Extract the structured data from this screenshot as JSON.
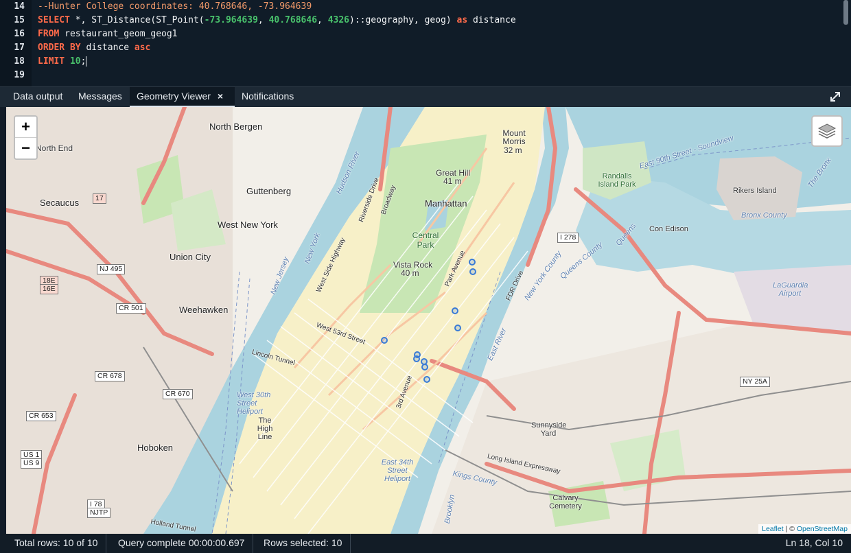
{
  "editor": {
    "lines": [
      {
        "n": "14",
        "parts": [
          {
            "t": "--Hunter College coordinates: 40.768646, -73.964639",
            "c": "comment"
          }
        ]
      },
      {
        "n": "15",
        "parts": [
          {
            "t": "SELECT",
            "c": "kw"
          },
          {
            "t": " *, ST_Distance(ST_Point(",
            "c": "plain"
          },
          {
            "t": "-73.964639",
            "c": "num"
          },
          {
            "t": ", ",
            "c": "plain"
          },
          {
            "t": "40.768646",
            "c": "num"
          },
          {
            "t": ", ",
            "c": "plain"
          },
          {
            "t": "4326",
            "c": "num"
          },
          {
            "t": ")::geography, geog) ",
            "c": "plain"
          },
          {
            "t": "as",
            "c": "kw"
          },
          {
            "t": " distance",
            "c": "plain"
          }
        ]
      },
      {
        "n": "16",
        "parts": [
          {
            "t": "FROM",
            "c": "kw"
          },
          {
            "t": " restaurant_geom_geog1",
            "c": "plain"
          }
        ]
      },
      {
        "n": "17",
        "parts": [
          {
            "t": "ORDER BY",
            "c": "kw"
          },
          {
            "t": " distance ",
            "c": "plain"
          },
          {
            "t": "asc",
            "c": "kw"
          }
        ]
      },
      {
        "n": "18",
        "parts": [
          {
            "t": "LIMIT",
            "c": "kw"
          },
          {
            "t": " ",
            "c": "plain"
          },
          {
            "t": "10",
            "c": "num"
          },
          {
            "t": ";",
            "c": "plain"
          }
        ]
      },
      {
        "n": "19",
        "parts": []
      }
    ]
  },
  "tabs": [
    {
      "label": "Data output",
      "active": false
    },
    {
      "label": "Messages",
      "active": false
    },
    {
      "label": "Geometry Viewer",
      "active": true,
      "close": "×"
    },
    {
      "label": "Notifications",
      "active": false
    }
  ],
  "map": {
    "zoom_in": "+",
    "zoom_out": "−",
    "places": [
      {
        "name": "North Bergen",
        "cls": "big"
      },
      {
        "name": "North End",
        "cls": ""
      },
      {
        "name": "Secaucus",
        "cls": "big"
      },
      {
        "name": "Guttenberg",
        "cls": "big"
      },
      {
        "name": "West New York",
        "cls": "big"
      },
      {
        "name": "Union City",
        "cls": "big"
      },
      {
        "name": "Weehawken",
        "cls": "big"
      },
      {
        "name": "Hoboken",
        "cls": "big"
      },
      {
        "name": "Manhattan",
        "cls": "big"
      },
      {
        "name": "Great Hill",
        "cls": ""
      },
      {
        "name": "41 m",
        "cls": ""
      },
      {
        "name": "Mount Morris",
        "cls": ""
      },
      {
        "name": "32 m",
        "cls": ""
      },
      {
        "name": "Central Park",
        "cls": "park"
      },
      {
        "name": "Vista Rock",
        "cls": ""
      },
      {
        "name": "40 m",
        "cls": ""
      },
      {
        "name": "Randalls Island Park",
        "cls": "park"
      },
      {
        "name": "Rikers Island",
        "cls": ""
      },
      {
        "name": "Bronx County",
        "cls": "water"
      },
      {
        "name": "Con Edison",
        "cls": ""
      },
      {
        "name": "Queens",
        "cls": "water"
      },
      {
        "name": "LaGuardia Airport",
        "cls": "water"
      },
      {
        "name": "The High Line",
        "cls": ""
      },
      {
        "name": "West 30th Street Heliport",
        "cls": "water"
      },
      {
        "name": "East 34th Street Heliport",
        "cls": "water"
      },
      {
        "name": "Sunnyside Yard",
        "cls": ""
      },
      {
        "name": "Calvary Cemetery",
        "cls": ""
      },
      {
        "name": "Kings County",
        "cls": "water"
      },
      {
        "name": "Brooklyn",
        "cls": "water"
      },
      {
        "name": "New Jersey",
        "cls": "water"
      },
      {
        "name": "New York",
        "cls": "water"
      },
      {
        "name": "Hudson River",
        "cls": "water"
      },
      {
        "name": "East River",
        "cls": "water"
      },
      {
        "name": "The Bronx",
        "cls": "water"
      },
      {
        "name": "East 90th Street - Soundview",
        "cls": "water"
      },
      {
        "name": "New York County",
        "cls": "water"
      },
      {
        "name": "Queens County",
        "cls": "water"
      },
      {
        "name": "Long Island Expressway",
        "cls": ""
      },
      {
        "name": "West 53rd Street",
        "cls": ""
      },
      {
        "name": "Broadway",
        "cls": ""
      },
      {
        "name": "3rd Avenue",
        "cls": ""
      },
      {
        "name": "Park Avenue",
        "cls": ""
      },
      {
        "name": "West Side Highway",
        "cls": ""
      },
      {
        "name": "FDR Drive",
        "cls": ""
      },
      {
        "name": "Riverside Drive",
        "cls": ""
      },
      {
        "name": "Lincoln Tunnel",
        "cls": ""
      },
      {
        "name": "Holland Tunnel",
        "cls": ""
      }
    ],
    "shields": [
      "CR 501",
      "CR 678",
      "CR 670",
      "CR 653",
      "NJ 495",
      "US 1",
      "US 9",
      "I 78",
      "NJTP",
      "I 278",
      "NY 25A",
      "17",
      "18E",
      "16E"
    ],
    "results_count": 10,
    "attribution_leaflet": "Leaflet",
    "attribution_sep": " | © ",
    "attribution_osm": "OpenStreetMap"
  },
  "status": {
    "total_rows": "Total rows: 10 of 10",
    "query": "Query complete 00:00:00.697",
    "selected": "Rows selected: 10",
    "cursor": "Ln 18, Col 10"
  },
  "colors": {
    "keyword": "#ff6a4a",
    "number": "#49c26c",
    "comment": "#f29a6a",
    "water": "#aad3df",
    "park": "#c8e6b4",
    "marker": "#3a7bd5"
  }
}
